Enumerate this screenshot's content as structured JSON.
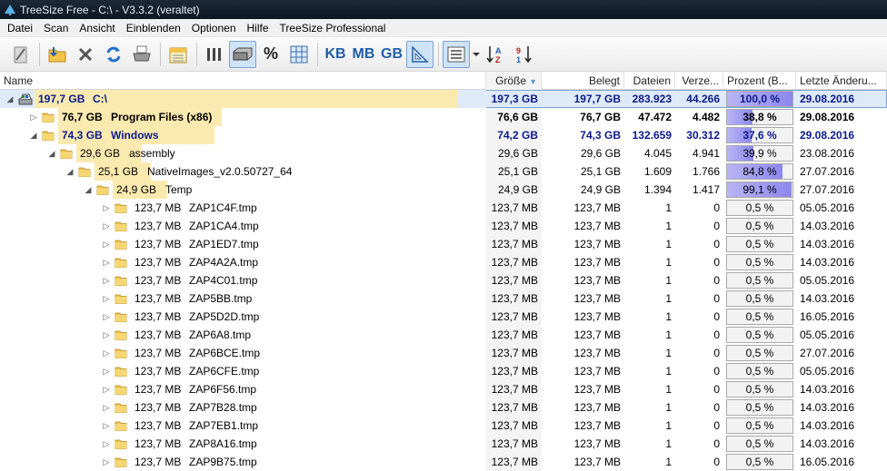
{
  "window": {
    "title": "TreeSize Free - C:\\ - V3.3.2 (veraltet)"
  },
  "menu": [
    "Datei",
    "Scan",
    "Ansicht",
    "Einblenden",
    "Optionen",
    "Hilfe",
    "TreeSize Professional"
  ],
  "toolbar": {
    "kb": "KB",
    "mb": "MB",
    "gb": "GB",
    "percent": "%"
  },
  "columns": {
    "name": "Name",
    "size": "Größe",
    "allocated": "Belegt",
    "files": "Dateien",
    "dirs": "Verze...",
    "percent": "Prozent (B...",
    "modified": "Letzte Änderu..."
  },
  "rows": [
    {
      "size_label": "197,7 GB",
      "name": "C:\\",
      "size": "197,3 GB",
      "allocated": "197,7 GB",
      "files": "283.923",
      "dirs": "44.266",
      "percent": "100,0 %",
      "percent_value": 100.0,
      "date": "29.08.2016"
    },
    {
      "size_label": "76,7 GB",
      "name": "Program Files (x86)",
      "size": "76,6 GB",
      "allocated": "76,7 GB",
      "files": "47.472",
      "dirs": "4.482",
      "percent": "38,8 %",
      "percent_value": 38.8,
      "date": "29.08.2016"
    },
    {
      "size_label": "74,3 GB",
      "name": "Windows",
      "size": "74,2 GB",
      "allocated": "74,3 GB",
      "files": "132.659",
      "dirs": "30.312",
      "percent": "37,6 %",
      "percent_value": 37.6,
      "date": "29.08.2016"
    },
    {
      "size_label": "29,6 GB",
      "name": "assembly",
      "size": "29,6 GB",
      "allocated": "29,6 GB",
      "files": "4.045",
      "dirs": "4.941",
      "percent": "39,9 %",
      "percent_value": 39.9,
      "date": "23.08.2016"
    },
    {
      "size_label": "25,1 GB",
      "name": "NativeImages_v2.0.50727_64",
      "size": "25,1 GB",
      "allocated": "25,1 GB",
      "files": "1.609",
      "dirs": "1.766",
      "percent": "84,8 %",
      "percent_value": 84.8,
      "date": "27.07.2016"
    },
    {
      "size_label": "24,9 GB",
      "name": "Temp",
      "size": "24,9 GB",
      "allocated": "24,9 GB",
      "files": "1.394",
      "dirs": "1.417",
      "percent": "99,1 %",
      "percent_value": 99.1,
      "date": "27.07.2016"
    },
    {
      "size_label": "123,7 MB",
      "name": "ZAP1C4F.tmp",
      "size": "123,7 MB",
      "allocated": "123,7 MB",
      "files": "1",
      "dirs": "0",
      "percent": "0,5 %",
      "percent_value": 0.5,
      "date": "05.05.2016"
    },
    {
      "size_label": "123,7 MB",
      "name": "ZAP1CA4.tmp",
      "size": "123,7 MB",
      "allocated": "123,7 MB",
      "files": "1",
      "dirs": "0",
      "percent": "0,5 %",
      "percent_value": 0.5,
      "date": "14.03.2016"
    },
    {
      "size_label": "123,7 MB",
      "name": "ZAP1ED7.tmp",
      "size": "123,7 MB",
      "allocated": "123,7 MB",
      "files": "1",
      "dirs": "0",
      "percent": "0,5 %",
      "percent_value": 0.5,
      "date": "14.03.2016"
    },
    {
      "size_label": "123,7 MB",
      "name": "ZAP4A2A.tmp",
      "size": "123,7 MB",
      "allocated": "123,7 MB",
      "files": "1",
      "dirs": "0",
      "percent": "0,5 %",
      "percent_value": 0.5,
      "date": "14.03.2016"
    },
    {
      "size_label": "123,7 MB",
      "name": "ZAP4C01.tmp",
      "size": "123,7 MB",
      "allocated": "123,7 MB",
      "files": "1",
      "dirs": "0",
      "percent": "0,5 %",
      "percent_value": 0.5,
      "date": "05.05.2016"
    },
    {
      "size_label": "123,7 MB",
      "name": "ZAP5BB.tmp",
      "size": "123,7 MB",
      "allocated": "123,7 MB",
      "files": "1",
      "dirs": "0",
      "percent": "0,5 %",
      "percent_value": 0.5,
      "date": "14.03.2016"
    },
    {
      "size_label": "123,7 MB",
      "name": "ZAP5D2D.tmp",
      "size": "123,7 MB",
      "allocated": "123,7 MB",
      "files": "1",
      "dirs": "0",
      "percent": "0,5 %",
      "percent_value": 0.5,
      "date": "16.05.2016"
    },
    {
      "size_label": "123,7 MB",
      "name": "ZAP6A8.tmp",
      "size": "123,7 MB",
      "allocated": "123,7 MB",
      "files": "1",
      "dirs": "0",
      "percent": "0,5 %",
      "percent_value": 0.5,
      "date": "05.05.2016"
    },
    {
      "size_label": "123,7 MB",
      "name": "ZAP6BCE.tmp",
      "size": "123,7 MB",
      "allocated": "123,7 MB",
      "files": "1",
      "dirs": "0",
      "percent": "0,5 %",
      "percent_value": 0.5,
      "date": "27.07.2016"
    },
    {
      "size_label": "123,7 MB",
      "name": "ZAP6CFE.tmp",
      "size": "123,7 MB",
      "allocated": "123,7 MB",
      "files": "1",
      "dirs": "0",
      "percent": "0,5 %",
      "percent_value": 0.5,
      "date": "05.05.2016"
    },
    {
      "size_label": "123,7 MB",
      "name": "ZAP6F56.tmp",
      "size": "123,7 MB",
      "allocated": "123,7 MB",
      "files": "1",
      "dirs": "0",
      "percent": "0,5 %",
      "percent_value": 0.5,
      "date": "14.03.2016"
    },
    {
      "size_label": "123,7 MB",
      "name": "ZAP7B28.tmp",
      "size": "123,7 MB",
      "allocated": "123,7 MB",
      "files": "1",
      "dirs": "0",
      "percent": "0,5 %",
      "percent_value": 0.5,
      "date": "14.03.2016"
    },
    {
      "size_label": "123,7 MB",
      "name": "ZAP7EB1.tmp",
      "size": "123,7 MB",
      "allocated": "123,7 MB",
      "files": "1",
      "dirs": "0",
      "percent": "0,5 %",
      "percent_value": 0.5,
      "date": "14.03.2016"
    },
    {
      "size_label": "123,7 MB",
      "name": "ZAP8A16.tmp",
      "size": "123,7 MB",
      "allocated": "123,7 MB",
      "files": "1",
      "dirs": "0",
      "percent": "0,5 %",
      "percent_value": 0.5,
      "date": "14.03.2016"
    },
    {
      "size_label": "123,7 MB",
      "name": "ZAP9B75.tmp",
      "size": "123,7 MB",
      "allocated": "123,7 MB",
      "files": "1",
      "dirs": "0",
      "percent": "0,5 %",
      "percent_value": 0.5,
      "date": "16.05.2016"
    }
  ]
}
